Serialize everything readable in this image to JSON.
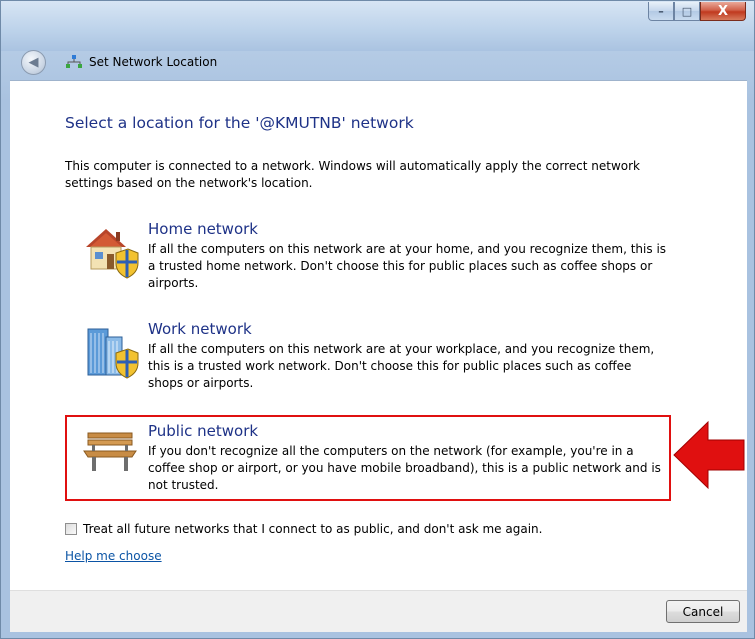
{
  "window": {
    "title": "Set Network Location",
    "caption_buttons": {
      "minimize": "–",
      "maximize": "□",
      "close": "X"
    }
  },
  "main": {
    "heading": "Select a location for the '@KMUTNB' network",
    "intro": "This computer is connected to a network. Windows will automatically apply the correct network settings based on the network's location.",
    "options": [
      {
        "title": "Home network",
        "description": "If all the computers on this network are at your home, and you recognize them, this is a trusted home network.  Don't choose this for public places such as coffee shops or airports.",
        "icon": "house-shield-icon"
      },
      {
        "title": "Work network",
        "description": "If all the computers on this network are at your workplace, and you recognize them, this is a trusted work network.  Don't choose this for public places such as coffee shops or airports.",
        "icon": "office-building-shield-icon"
      },
      {
        "title": "Public network",
        "description": "If you don't recognize all the computers on the network (for example, you're in a coffee shop or airport, or you have mobile broadband), this is a public network and is not trusted.",
        "icon": "park-bench-icon",
        "highlighted": true
      }
    ],
    "checkbox": {
      "label": "Treat all future networks that I connect to as public, and don't ask me again.",
      "checked": false
    },
    "help_link": "Help me choose"
  },
  "footer": {
    "cancel_label": "Cancel"
  },
  "colors": {
    "heading": "#1e3287",
    "link": "#0b54a5",
    "highlight_border": "#e01010",
    "arrow": "#e01010"
  }
}
